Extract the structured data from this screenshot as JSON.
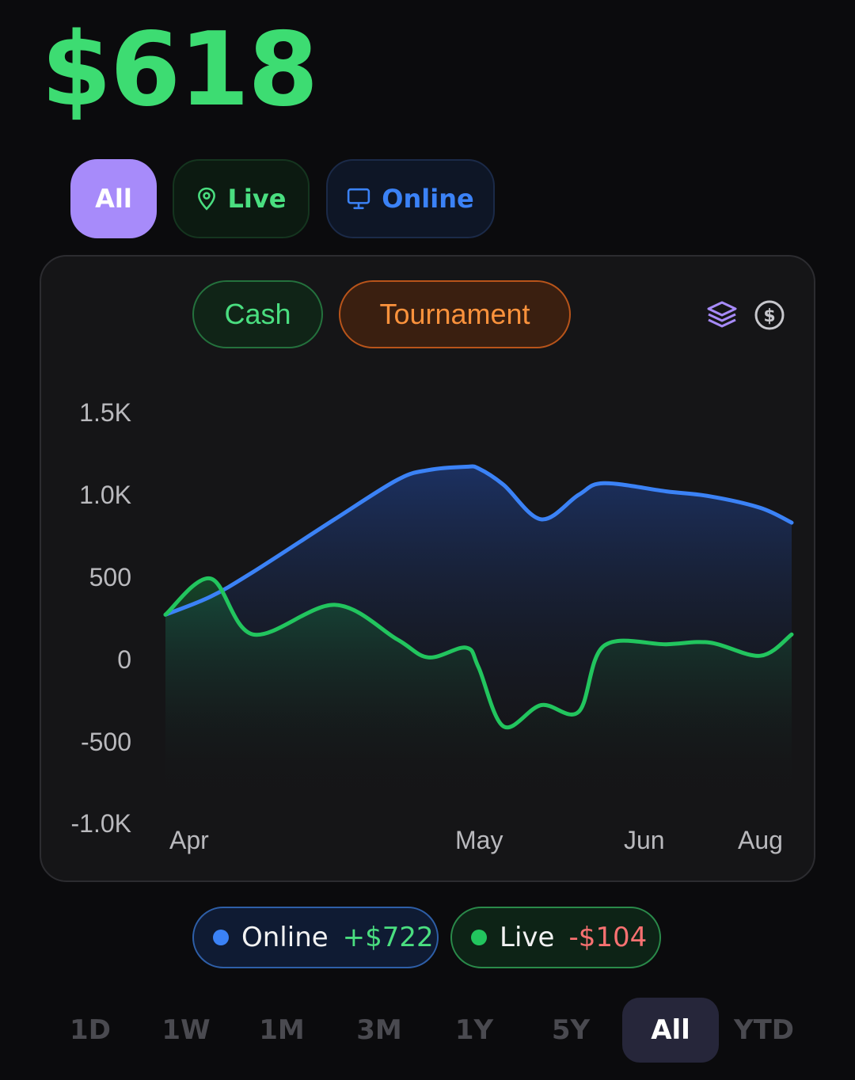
{
  "header": {
    "total": "$618"
  },
  "filters": {
    "all": "All",
    "live": "Live",
    "online": "Online"
  },
  "game_types": {
    "cash": "Cash",
    "tournament": "Tournament"
  },
  "legend": {
    "online": {
      "label": "Online",
      "value": "+$722"
    },
    "live": {
      "label": "Live",
      "value": "-$104"
    }
  },
  "ranges": [
    "1D",
    "1W",
    "1M",
    "3M",
    "1Y",
    "5Y",
    "All",
    "YTD"
  ],
  "active_range": "All",
  "colors": {
    "online": "#3b82f6",
    "live": "#22c55e",
    "accent": "#a78bfa",
    "tournament": "#fb923c"
  },
  "icons": [
    "map-pin-icon",
    "monitor-icon",
    "layers-icon",
    "dollar-circle-icon"
  ],
  "chart_data": {
    "type": "area",
    "yticks": [
      "1.5K",
      "1.0K",
      "500",
      "0",
      "-500",
      "-1.0K"
    ],
    "ylim": [
      -1000,
      1500
    ],
    "xticks": [
      "Apr",
      "May",
      "Jun",
      "Aug"
    ],
    "x": [
      0,
      0.072,
      0.14,
      0.27,
      0.37,
      0.42,
      0.48,
      0.5,
      0.54,
      0.6,
      0.66,
      0.7,
      0.8,
      0.87,
      0.95,
      1.0
    ],
    "series": [
      {
        "name": "Online",
        "values": [
          270,
          380,
          530,
          850,
          1090,
          1150,
          1170,
          1160,
          1060,
          850,
          1000,
          1070,
          1020,
          990,
          920,
          830
        ]
      },
      {
        "name": "Live",
        "values": [
          270,
          490,
          150,
          330,
          120,
          10,
          70,
          -50,
          -410,
          -280,
          -320,
          80,
          90,
          100,
          20,
          150
        ]
      }
    ]
  }
}
